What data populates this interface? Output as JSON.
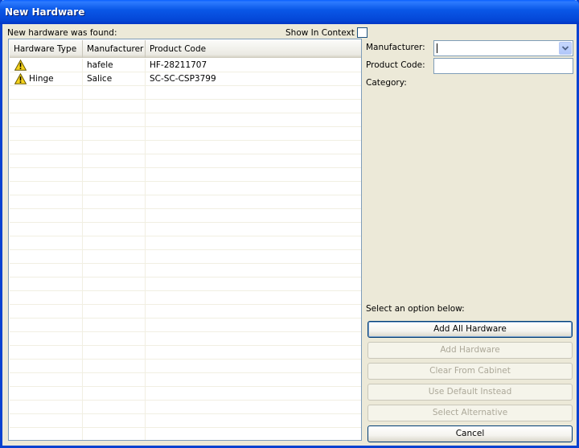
{
  "window": {
    "title": "New Hardware"
  },
  "found_label": "New hardware was found:",
  "show_in_context": {
    "label": "Show In Context",
    "checked": false
  },
  "table": {
    "columns": [
      "Hardware Type",
      "Manufacturer",
      "Product Code"
    ],
    "rows": [
      {
        "hardware_type": "",
        "manufacturer": "hafele",
        "product_code": "HF-28211707",
        "icon": "warning-icon"
      },
      {
        "hardware_type": "Hinge",
        "manufacturer": "Salice",
        "product_code": "SC-SC-CSP3799",
        "icon": "warning-icon"
      }
    ]
  },
  "form": {
    "manufacturer_label": "Manufacturer:",
    "manufacturer_value": "",
    "product_code_label": "Product Code:",
    "product_code_value": "",
    "category_label": "Category:"
  },
  "options": {
    "prompt": "Select an option below:",
    "add_all": "Add All Hardware",
    "add": "Add Hardware",
    "clear": "Clear From Cabinet",
    "use_default": "Use Default Instead",
    "select_alt": "Select Alternative",
    "cancel": "Cancel"
  },
  "colors": {
    "title_bar": "#0a58e8",
    "window_bg": "#ece9d8",
    "warning": "#f5d21a"
  }
}
